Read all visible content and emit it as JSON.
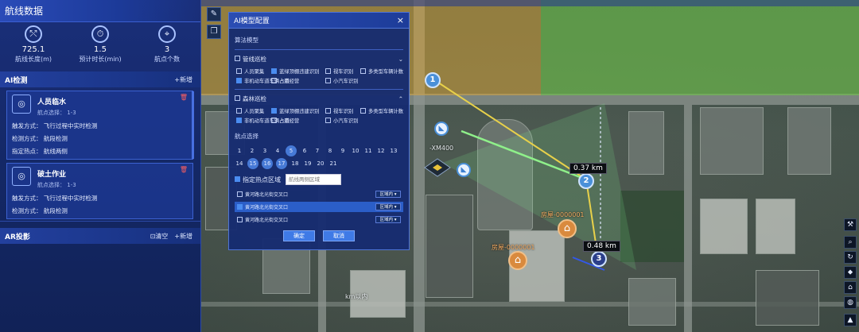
{
  "left_panel": {
    "title": "航线数据",
    "stats": [
      {
        "icon": "route-length-icon",
        "glyph": "⤲",
        "value": "725.1",
        "label": "航线长度(m)"
      },
      {
        "icon": "clock-icon",
        "glyph": "⏱",
        "value": "1.5",
        "label": "预计时长(min)"
      },
      {
        "icon": "waypoint-icon",
        "glyph": "⌖",
        "value": "3",
        "label": "航点个数"
      }
    ],
    "ai_section": {
      "title": "AI检测",
      "add_label": "+新增"
    },
    "cards": [
      {
        "name": "人员临水",
        "sub": "航点选择： 1-3",
        "trigger": "触发方式： 飞行过程中实时检测",
        "method": "检测方式： 航段检测",
        "extra": "指定热点： 航线两侧"
      },
      {
        "name": "破土作业",
        "sub": "航点选择： 1-3",
        "trigger": "触发方式： 飞行过程中实时检测",
        "method": "检测方式： 航段检测"
      }
    ],
    "ar_section": {
      "title": "AR投影",
      "clear_label": "清空",
      "add_label": "+新增"
    }
  },
  "dialog": {
    "title": "AI模型配置",
    "close": "×",
    "algo_label": "算法模型",
    "groups": [
      {
        "name": "管线巡检",
        "options": [
          {
            "label": "人员聚集",
            "on": false
          },
          {
            "label": "蓝绿顶棚违建识别",
            "on": true
          },
          {
            "label": "视车识别",
            "on": false
          },
          {
            "label": "多类型车辆计数",
            "on": false
          },
          {
            "label": "非机动车道车辆占用",
            "on": true
          },
          {
            "label": "占道经营",
            "on": false
          },
          {
            "label": "小汽车识别",
            "on": false
          }
        ]
      },
      {
        "name": "森林巡检",
        "options": [
          {
            "label": "人员聚集",
            "on": false
          },
          {
            "label": "蓝绿顶棚违建识别",
            "on": true
          },
          {
            "label": "视车识别",
            "on": false
          },
          {
            "label": "多类型车辆计数",
            "on": false
          },
          {
            "label": "非机动车道车辆占用",
            "on": true
          },
          {
            "label": "占道经营",
            "on": false
          },
          {
            "label": "小汽车识别",
            "on": false
          }
        ]
      }
    ],
    "waypoint_label": "航点选择",
    "waypoints": [
      "1",
      "2",
      "3",
      "4",
      "5",
      "6",
      "7",
      "8",
      "9",
      "10",
      "11",
      "12",
      "13",
      "14",
      "15",
      "16",
      "17",
      "18",
      "19",
      "20",
      "21"
    ],
    "selected_waypoints": [
      "5",
      "15",
      "16",
      "17"
    ],
    "region_checkbox": "指定热点区域",
    "region_placeholder": "航线两侧区域",
    "regions": [
      {
        "label": "黄河路北光街交叉口",
        "drop": "区域内 ▾",
        "on": false
      },
      {
        "label": "黄河路北光街交叉口",
        "drop": "区域内 ▾",
        "on": true
      },
      {
        "label": "黄河路北光街交叉口",
        "drop": "区域内 ▾",
        "on": false
      }
    ],
    "ok": "确定",
    "cancel": "取消"
  },
  "map": {
    "distance_labels": [
      "0.37 km",
      "0.48 km"
    ],
    "waypoint_numbers": [
      "1",
      "2",
      "3"
    ],
    "aircraft_label": "-XM400",
    "poi_labels": [
      "房屋-0000001",
      "房屋-0000001"
    ],
    "road_label": "km以内"
  },
  "toolbar_left": [
    "pin-icon",
    "layers-icon"
  ],
  "toolbar_right": [
    "measure-icon",
    "search-icon",
    "refresh-icon",
    "compass-icon",
    "home-icon",
    "globe-icon",
    "mountain-icon"
  ],
  "colors": {
    "panel": "#142866",
    "accent": "#4a8cf0",
    "zone_orange": "#d9a43a",
    "zone_green": "#6fbf4c",
    "danger": "#ff5f5f"
  }
}
